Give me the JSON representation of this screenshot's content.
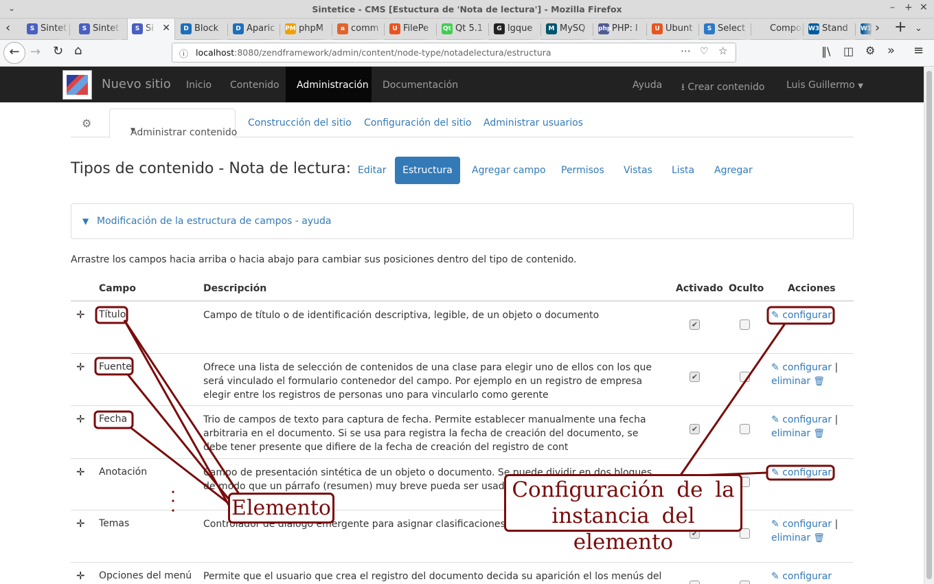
{
  "window": {
    "title": "Sintetice - CMS [Estuctura de 'Nota de lectura'] - Mozilla Firefox"
  },
  "tabs": [
    {
      "label": "Sintet",
      "icon": "s-logo"
    },
    {
      "label": "Sintet",
      "icon": "s-logo"
    },
    {
      "label": "Si",
      "icon": "s-logo",
      "active": true
    },
    {
      "label": "Block",
      "icon": "drupal"
    },
    {
      "label": "Aparic",
      "icon": "drupal"
    },
    {
      "label": "phpM",
      "icon": "pma"
    },
    {
      "label": "comm",
      "icon": "ask"
    },
    {
      "label": "FilePe",
      "icon": "ubuntu"
    },
    {
      "label": "Qt 5.1",
      "icon": "qt"
    },
    {
      "label": "lgque",
      "icon": "github"
    },
    {
      "label": "MySQ",
      "icon": "mysql"
    },
    {
      "label": "PHP: l",
      "icon": "php"
    },
    {
      "label": "Ubunt",
      "icon": "ubuntu"
    },
    {
      "label": "Select",
      "icon": "s-blue"
    },
    {
      "label": "Compone",
      "icon": "none"
    },
    {
      "label": "Stand",
      "icon": "w3"
    },
    {
      "label": "W",
      "icon": "w3"
    }
  ],
  "address": {
    "host": "localhost",
    "rest": ":8080/zendframework/admin/content/node-type/notadelectura/estructura"
  },
  "site": {
    "brand": "Nuevo sitio",
    "nav": [
      "Inicio",
      "Contenido",
      "Administración",
      "Documentación"
    ],
    "right": {
      "help": "Ayuda",
      "create": "Crear contenido",
      "user": "Luis Guillermo"
    }
  },
  "admin_tabs": {
    "active": "Administrar contenido",
    "others": [
      "Construcción del sitio",
      "Configuración del sitio",
      "Administrar usuarios"
    ]
  },
  "page": {
    "title": "Tipos de contenido - Nota de lectura:",
    "pills": [
      "Editar",
      "Estructura",
      "Agregar campo",
      "Permisos",
      "Vistas",
      "Lista",
      "Agregar"
    ],
    "help_panel": "Modificación de la estructura de campos - ayuda",
    "intro": "Arrastre los campos hacia arriba o hacia abajo para cambiar sus posiciones dentro del tipo de contenido."
  },
  "table": {
    "headers": {
      "field": "Campo",
      "desc": "Descripción",
      "enabled": "Activado",
      "hidden": "Oculto",
      "actions": "Acciones"
    },
    "action_labels": {
      "configure": "configurar",
      "delete": "eliminar",
      "sep": "|"
    },
    "rows": [
      {
        "field": "Título",
        "desc": "Campo de título o de identificación descriptiva, legible, de un objeto o documento",
        "enabled": true,
        "hidden": false,
        "deletable": false
      },
      {
        "field": "Fuente",
        "desc": "Ofrece una lista de selección de contenidos de una clase para elegir uno de ellos con los que será vinculado el formulario contenedor del campo. Por ejemplo en un registro de empresa elegir entre los registros de personas uno para vincularlo como gerente",
        "enabled": true,
        "hidden": false,
        "deletable": true
      },
      {
        "field": "Fecha",
        "desc": "Trio de campos de texto para captura de fecha. Permite establecer manualmente una fecha arbitraria en el documento. Si se usa para registra la fecha de creación del documento, se debe tener presente que difiere de la fecha de creación del registro de cont",
        "enabled": true,
        "hidden": false,
        "deletable": true
      },
      {
        "field": "Anotación",
        "desc": "Campo de presentación sintética de un objeto o documento. Se puede dividir en dos bloques de modo que un párrafo (resumen) muy breve pueda ser usado en listados y re",
        "enabled": false,
        "hidden": false,
        "deletable": false
      },
      {
        "field": "Temas",
        "desc": "Controlador de dialogo emergente para asignar clasificaciones múltiples",
        "enabled": true,
        "hidden": false,
        "deletable": true
      },
      {
        "field": "Opciones del menú",
        "desc": "Permite que el usuario que crea el registro del documento decida su aparición el los menús del sitio; es",
        "enabled": false,
        "hidden": false,
        "deletable": false
      }
    ]
  },
  "annotations": {
    "element_label": "Elemento",
    "config_label_line1": "Configuración de la",
    "config_label_line2": "instancia del elemento",
    "color": "#7a0b0b"
  }
}
